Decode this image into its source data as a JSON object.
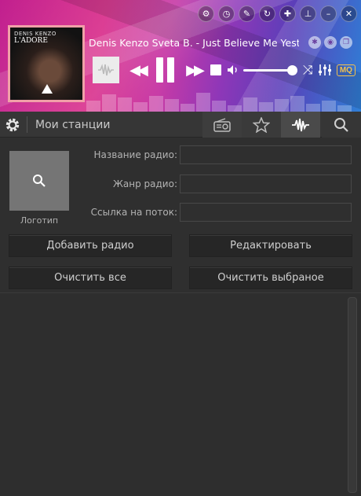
{
  "player": {
    "cover": {
      "artist_text": "DENIS KENZO",
      "album_text": "L'ADORE"
    },
    "track_title": "Denis Kenzo  Sveta B. - Just Believe Me Yesterday",
    "volume_level": 1.0,
    "quality_badge": "MQ",
    "icons": {
      "window": [
        "settings-icon",
        "timer-icon",
        "skin-icon",
        "refresh-icon",
        "tools-icon",
        "pin-icon",
        "minimize-icon",
        "close-icon"
      ],
      "track": [
        "share-icon",
        "chrome-icon",
        "copy-icon"
      ],
      "controls": [
        "waveform-icon",
        "previous-icon",
        "pause-icon",
        "next-icon",
        "stop-icon",
        "volume-icon",
        "shuffle-icon",
        "equalizer-icon"
      ]
    },
    "colors": {
      "accent_gold": "#f2c14e",
      "header_pink": "#c11f8e",
      "header_blue": "#2f7fd6"
    }
  },
  "toolbar": {
    "title": "Мои станции",
    "tabs": [
      "radio-icon",
      "star-icon",
      "waveform-icon",
      "search-icon"
    ],
    "active_tab": "waveform-icon"
  },
  "form": {
    "logo_caption": "Логотип",
    "name_label": "Название радио:",
    "name_value": "",
    "genre_label": "Жанр радио:",
    "genre_value": "",
    "url_label": "Ссылка на поток:",
    "url_value": ""
  },
  "buttons": {
    "add": "Добавить радио",
    "edit": "Редактировать",
    "clear_all": "Очистить все",
    "clear_selected": "Очистить выбраное"
  },
  "stations": []
}
